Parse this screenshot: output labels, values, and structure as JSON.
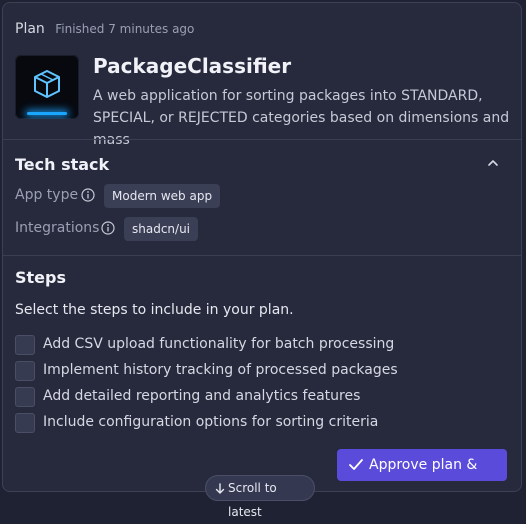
{
  "header": {
    "plan_label": "Plan",
    "status": "Finished 7 minutes ago"
  },
  "app": {
    "icon": "cube-icon",
    "title": "PackageClassifier",
    "description": "A web application for sorting packages into STANDARD, SPECIAL, or REJECTED categories based on dimensions and mass"
  },
  "tech_stack": {
    "title": "Tech stack",
    "rows": [
      {
        "label": "App type",
        "value": "Modern web app"
      },
      {
        "label": "Integrations",
        "value": "shadcn/ui"
      }
    ]
  },
  "steps": {
    "title": "Steps",
    "subtitle": "Select the steps to include in your plan.",
    "items": [
      {
        "label": "Add CSV upload functionality for batch processing",
        "checked": false
      },
      {
        "label": "Implement history tracking of processed packages",
        "checked": false
      },
      {
        "label": "Add detailed reporting and analytics features",
        "checked": false
      },
      {
        "label": "Include configuration options for sorting criteria",
        "checked": false
      }
    ]
  },
  "actions": {
    "approve_label": "Approve plan & start",
    "scroll_label": "Scroll to latest"
  },
  "colors": {
    "accent": "#5b4bdb",
    "background": "#262a3c",
    "glow": "#1aa6ff"
  }
}
